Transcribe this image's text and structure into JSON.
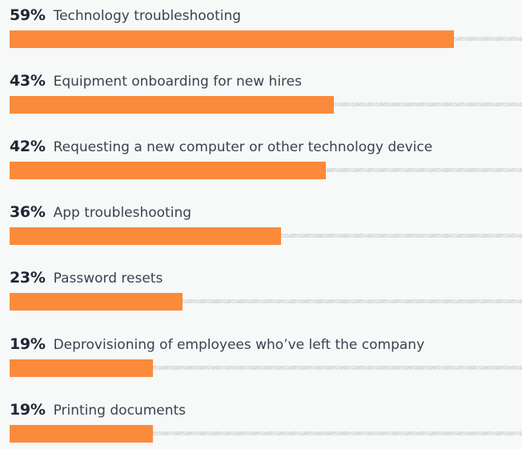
{
  "chart_data": {
    "type": "bar",
    "orientation": "horizontal",
    "categories": [
      "Technology troubleshooting",
      "Equipment onboarding for new hires",
      "Requesting a new computer or other technology device",
      "App troubleshooting",
      "Password resets",
      "Deprovisioning of employees who’ve left the company",
      "Printing documents"
    ],
    "values": [
      59,
      43,
      42,
      36,
      23,
      19,
      19
    ],
    "value_labels": [
      "59%",
      "43%",
      "42%",
      "36%",
      "23%",
      "19%",
      "19%"
    ],
    "xlim": [
      0,
      100
    ],
    "title": "",
    "xlabel": "",
    "ylabel": "",
    "grid": false,
    "colors": {
      "bar": "#fb8a3b",
      "track": "#c9cccf",
      "value_text": "#1e2636",
      "label_text": "#3a4250",
      "background": "#f7f8f8"
    }
  }
}
